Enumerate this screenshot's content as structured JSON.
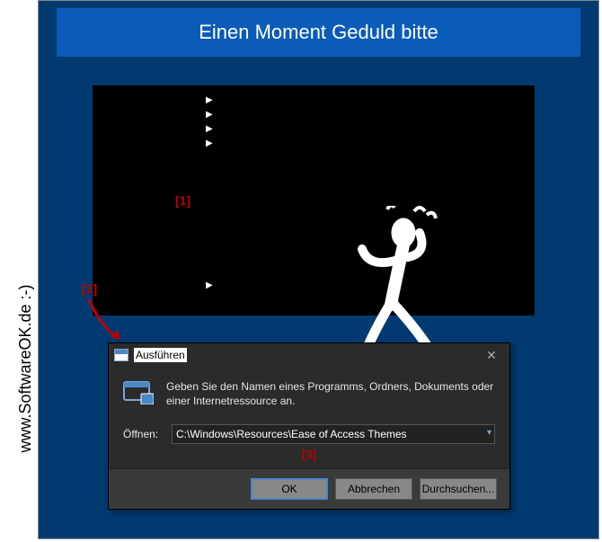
{
  "header": {
    "title": "Einen Moment Geduld bitte"
  },
  "markers": {
    "m1": "[1]",
    "m2": "[2]",
    "m3": "[3]"
  },
  "run_dialog": {
    "title": "Ausführen",
    "description": "Geben Sie den Namen eines Programms, Ordners, Dokuments oder einer Internetressource an.",
    "open_label": "Öffnen:",
    "input_value": "C:\\Windows\\Resources\\Ease of Access Themes",
    "buttons": {
      "ok": "OK",
      "cancel": "Abbrechen",
      "browse": "Durchsuchen..."
    }
  },
  "watermark": "www.SoftwareOK.de :-)"
}
